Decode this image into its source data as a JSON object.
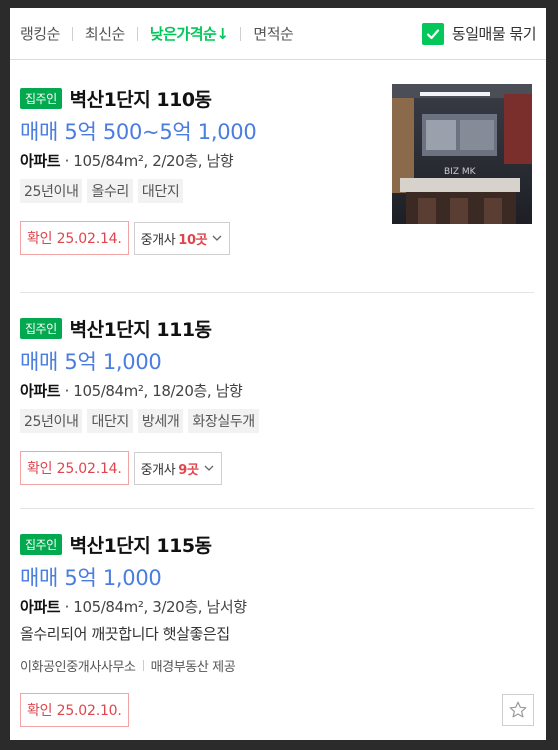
{
  "sort": {
    "items": [
      "랭킹순",
      "최신순",
      "낮은가격순↓",
      "면적순"
    ],
    "group_label": "동일매물 묶기"
  },
  "listings": [
    {
      "owner_badge": "집주인",
      "title": "벽산1단지 110동",
      "price": "매매 5억 500~5억 1,000",
      "type": "아파트",
      "spec": " · 105/84m², 2/20층, 남향",
      "tags": [
        "25년이내",
        "올수리",
        "대단지"
      ],
      "confirm": "확인 25.02.14.",
      "broker_label": "중개사",
      "broker_count": "10곳",
      "thumb_caption": "BIZ MK"
    },
    {
      "owner_badge": "집주인",
      "title": "벽산1단지 111동",
      "price": "매매 5억 1,000",
      "type": "아파트",
      "spec": " · 105/84m², 18/20층, 남향",
      "tags": [
        "25년이내",
        "대단지",
        "방세개",
        "화장실두개"
      ],
      "confirm": "확인 25.02.14.",
      "broker_label": "중개사",
      "broker_count": "9곳"
    },
    {
      "owner_badge": "집주인",
      "title": "벽산1단지 115동",
      "price": "매매 5억 1,000",
      "type": "아파트",
      "spec": " · 105/84m², 3/20층, 남서향",
      "description": "올수리되어 깨끗합니다 햇살좋은집",
      "agency": "이화공인중개사사무소",
      "provider": "매경부동산 제공",
      "confirm": "확인 25.02.10."
    }
  ],
  "colors": {
    "accent_green": "#03c75a",
    "price_blue": "#4a7de0",
    "confirm_red": "#e0454b"
  }
}
